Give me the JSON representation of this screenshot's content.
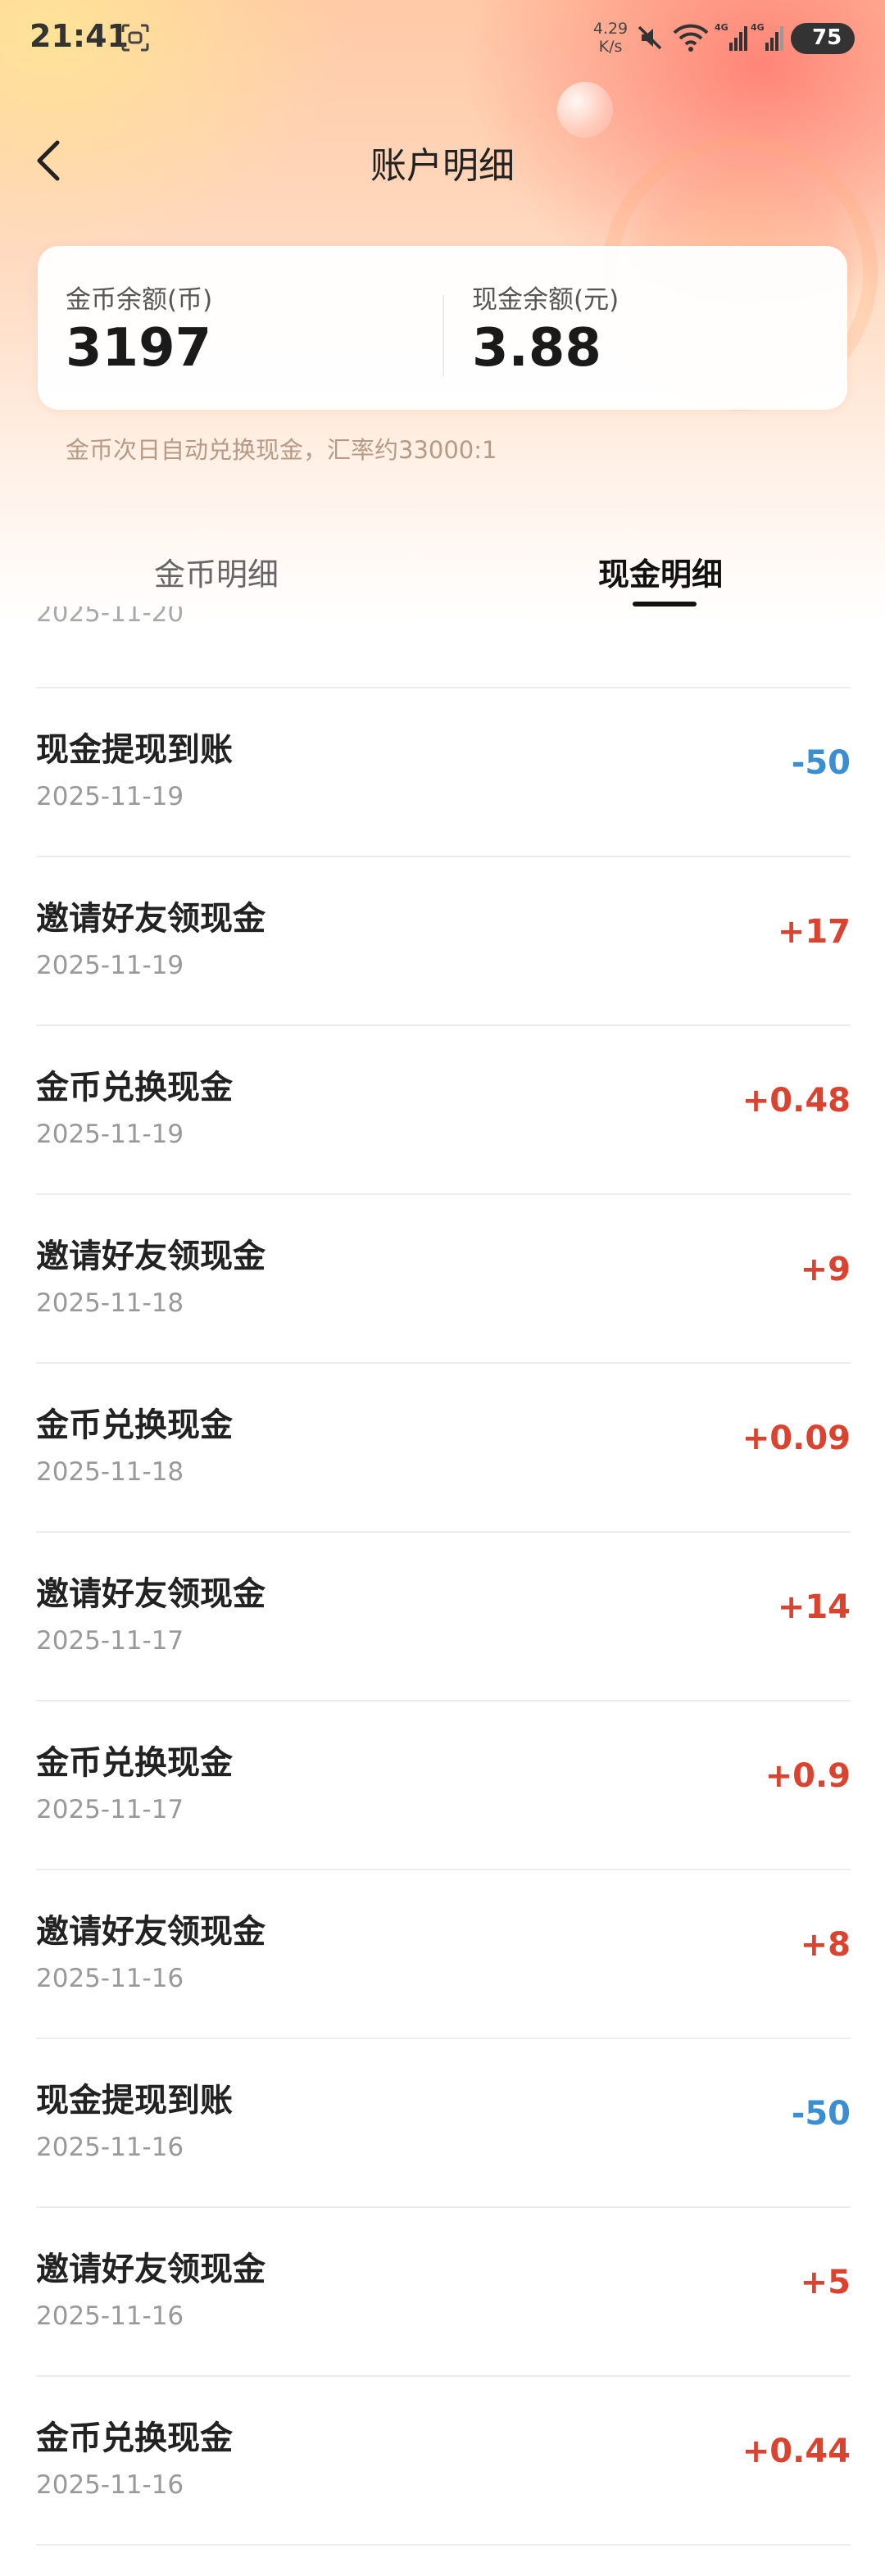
{
  "status_bar": {
    "time": "21:41",
    "net_speed_value": "4.29",
    "net_speed_unit": "K/s",
    "battery": "75",
    "signal_labels": [
      "4G",
      "4G"
    ]
  },
  "header": {
    "title": "账户明细"
  },
  "balances": {
    "coin_label": "金币余额(币)",
    "coin_value": "3197",
    "cash_label": "现金余额(元)",
    "cash_value": "3.88",
    "note": "金币次日自动兑换现金，汇率约33000:1"
  },
  "tabs": [
    {
      "label": "金币明细",
      "active": false
    },
    {
      "label": "现金明细",
      "active": true
    }
  ],
  "list": {
    "partial_date": "2025-11-20",
    "items": [
      {
        "title": "现金提现到账",
        "date": "2025-11-19",
        "amount": "-50",
        "type": "debit"
      },
      {
        "title": "邀请好友领现金",
        "date": "2025-11-19",
        "amount": "+17",
        "type": "credit"
      },
      {
        "title": "金币兑换现金",
        "date": "2025-11-19",
        "amount": "+0.48",
        "type": "credit"
      },
      {
        "title": "邀请好友领现金",
        "date": "2025-11-18",
        "amount": "+9",
        "type": "credit"
      },
      {
        "title": "金币兑换现金",
        "date": "2025-11-18",
        "amount": "+0.09",
        "type": "credit"
      },
      {
        "title": "邀请好友领现金",
        "date": "2025-11-17",
        "amount": "+14",
        "type": "credit"
      },
      {
        "title": "金币兑换现金",
        "date": "2025-11-17",
        "amount": "+0.9",
        "type": "credit"
      },
      {
        "title": "邀请好友领现金",
        "date": "2025-11-16",
        "amount": "+8",
        "type": "credit"
      },
      {
        "title": "现金提现到账",
        "date": "2025-11-16",
        "amount": "-50",
        "type": "debit"
      },
      {
        "title": "邀请好友领现金",
        "date": "2025-11-16",
        "amount": "+5",
        "type": "credit"
      },
      {
        "title": "金币兑换现金",
        "date": "2025-11-16",
        "amount": "+0.44",
        "type": "credit"
      }
    ]
  },
  "colors": {
    "credit": "#d9432f",
    "debit": "#3b8fd0"
  },
  "icons": {
    "back": "chevron-left-icon",
    "scan": "scan-icon",
    "mute": "mute-icon",
    "wifi": "wifi-icon",
    "signal": "signal-icon",
    "battery": "battery-icon"
  }
}
